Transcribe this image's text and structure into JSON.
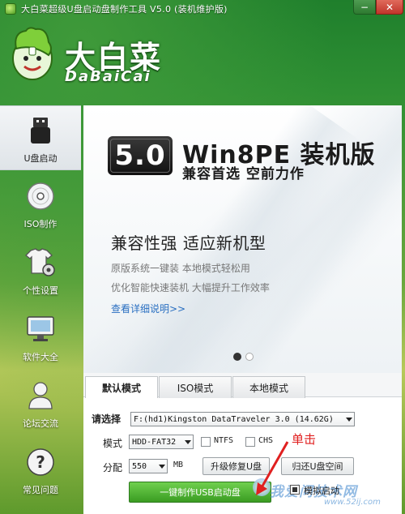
{
  "window": {
    "title": "大白菜超级U盘启动盘制作工具 V5.0 (装机维护版)",
    "minimize_glyph": "−",
    "close_glyph": "✕"
  },
  "logo": {
    "title": "大白菜",
    "subtitle": "DaBaiCai"
  },
  "sidebar": {
    "items": [
      {
        "label": "U盘启动",
        "icon": "usb-drive-icon",
        "active": true
      },
      {
        "label": "ISO制作",
        "icon": "disc-icon",
        "active": false
      },
      {
        "label": "个性设置",
        "icon": "shirt-gear-icon",
        "active": false
      },
      {
        "label": "软件大全",
        "icon": "monitor-icon",
        "active": false
      },
      {
        "label": "论坛交流",
        "icon": "user-icon",
        "active": false
      },
      {
        "label": "常见问题",
        "icon": "question-icon",
        "active": false
      }
    ]
  },
  "banner": {
    "version": "5.0",
    "headline": "Win8PE 装机版",
    "tagline": "兼容首选 空前力作",
    "heading2": "兼容性强 适应新机型",
    "line1": "原版系统一键装 本地模式轻松用",
    "line2": "优化智能快速装机 大幅提升工作效率",
    "link": "查看详细说明>>"
  },
  "tabs": [
    {
      "label": "默认模式",
      "active": true
    },
    {
      "label": "ISO模式",
      "active": false
    },
    {
      "label": "本地模式",
      "active": false
    }
  ],
  "form": {
    "select_label": "请选择",
    "device_value": "F:(hd1)Kingston DataTraveler 3.0 (14.62G)",
    "mode_label": "模式",
    "mode_value": "HDD-FAT32",
    "ntfs_label": "NTFS",
    "chs_label": "CHS",
    "alloc_label": "分配",
    "alloc_value": "550",
    "alloc_unit": "MB",
    "upgrade_button": "升级修复U盘",
    "restore_button": "归还U盘空间",
    "make_button": "一键制作USB启动盘",
    "sim_boot_label": "模拟启动"
  },
  "annotation": {
    "text": "单击",
    "color": "#e02020"
  },
  "watermark": {
    "text": "我爱问技术网",
    "url": "www.52ij.com"
  },
  "colors": {
    "accent_green": "#3a9c22",
    "link_blue": "#2a6fc1",
    "close_red": "#c0352b"
  }
}
